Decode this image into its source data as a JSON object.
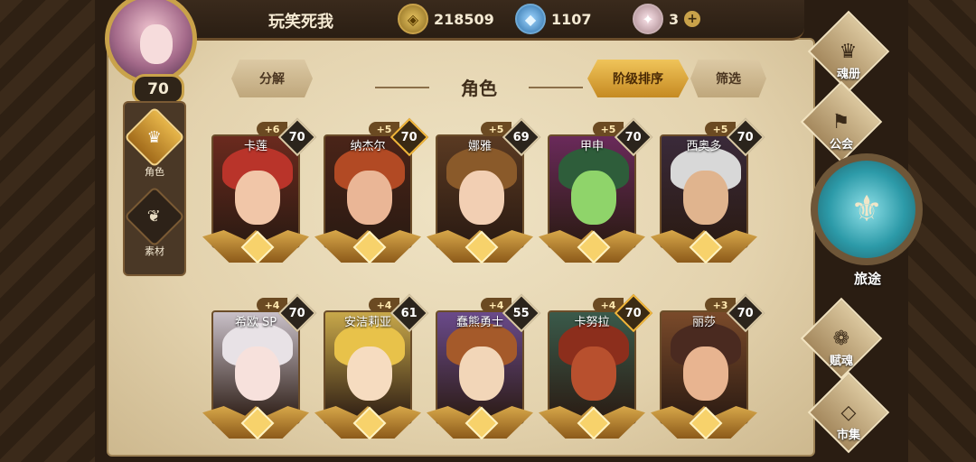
{
  "player": {
    "name": "玩笑死我",
    "level": "70"
  },
  "resources": [
    {
      "icon": "gold-coin-icon",
      "value": "218509"
    },
    {
      "icon": "blue-gem-icon",
      "value": "1107"
    },
    {
      "icon": "crystal-icon",
      "value": "3"
    }
  ],
  "sidebar": [
    {
      "label": "角色",
      "icon": "helmet-icon",
      "active": true
    },
    {
      "label": "素材",
      "icon": "wolf-icon",
      "active": false
    }
  ],
  "toolbar": {
    "decompose": "分解",
    "title": "角色",
    "sort": "阶级排序",
    "filter": "筛选"
  },
  "characters": [
    {
      "name": "卡莲",
      "plus": "+6",
      "level": "70",
      "hair": "#b9342a",
      "skin": "#f1c6a8",
      "bg": "#6b2a1e"
    },
    {
      "name": "纳杰尔",
      "plus": "+5",
      "level": "70",
      "hair": "#b24a24",
      "skin": "#eab696",
      "bg": "#4a2418",
      "gold": true
    },
    {
      "name": "娜雅",
      "plus": "+5",
      "level": "69",
      "hair": "#8a5a2a",
      "skin": "#f2cfb3",
      "bg": "#5a3a22"
    },
    {
      "name": "甲申",
      "plus": "+5",
      "level": "70",
      "hair": "#2e5d3a",
      "skin": "#8fd46a",
      "bg": "#6a2a5a"
    },
    {
      "name": "西奥多",
      "plus": "+5",
      "level": "70",
      "hair": "#d8d8d8",
      "skin": "#e0b48e",
      "bg": "#3a2a3a"
    },
    {
      "name": "希欧 SP",
      "plus": "+4",
      "level": "70",
      "hair": "#e8e2e6",
      "skin": "#f7e1dc",
      "bg": "#c9c0c8"
    },
    {
      "name": "安洁莉亚",
      "plus": "+4",
      "level": "61",
      "hair": "#e8c24a",
      "skin": "#f6dcc0",
      "bg": "#c8a84a"
    },
    {
      "name": "蠢熊勇士",
      "plus": "+4",
      "level": "55",
      "hair": "#a55a2a",
      "skin": "#f2d6b8",
      "bg": "#6a4a8a"
    },
    {
      "name": "卡努拉",
      "plus": "+4",
      "level": "70",
      "hair": "#8c2e1c",
      "skin": "#b8502e",
      "bg": "#3a5a4a",
      "gold": true
    },
    {
      "name": "丽莎",
      "plus": "+3",
      "level": "70",
      "hair": "#4a2a20",
      "skin": "#e8b490",
      "bg": "#7a4a2a"
    }
  ],
  "right_menu": {
    "soulbook": "魂册",
    "guild": "公会",
    "journey": "旅途",
    "soul_bestow": "赋魂",
    "market": "市集"
  }
}
